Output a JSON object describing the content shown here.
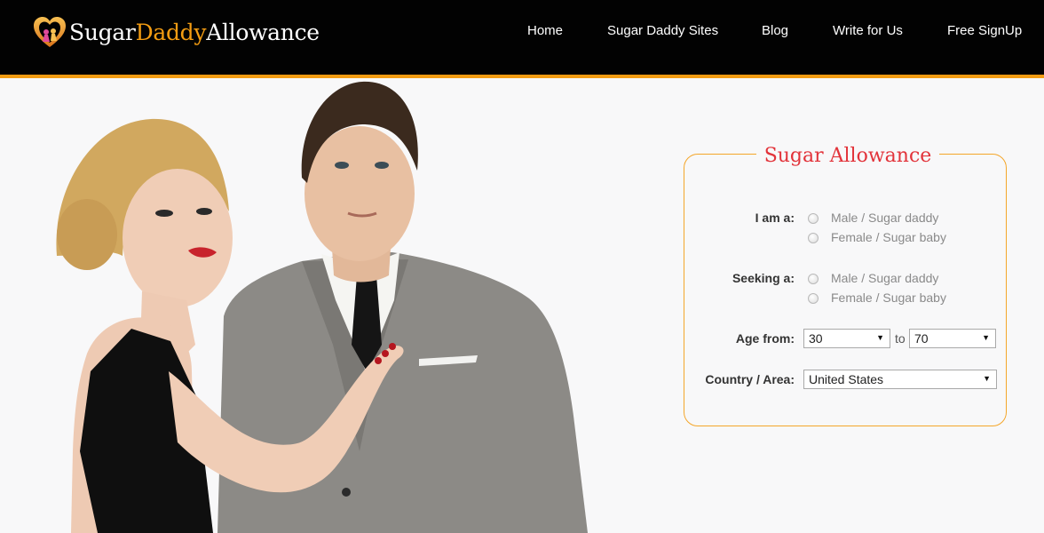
{
  "brand": {
    "logo_part1": "Sugar",
    "logo_part2": "Daddy",
    "logo_part3": "Allowance",
    "accent_color": "#f39c12"
  },
  "nav": {
    "items": [
      "Home",
      "Sugar Daddy Sites",
      "Blog",
      "Write for Us",
      "Free SignUp"
    ]
  },
  "hero": {
    "image": "couple-photo"
  },
  "form": {
    "title": "Sugar Allowance",
    "title_color": "#e2333a",
    "border_color": "#f4a62a",
    "i_am_label": "I am a:",
    "i_am_options": [
      "Male / Sugar daddy",
      "Female / Sugar baby"
    ],
    "seeking_label": "Seeking a:",
    "seeking_options": [
      "Male / Sugar daddy",
      "Female / Sugar baby"
    ],
    "age_label": "Age from:",
    "age_from": "30",
    "age_to_label": "to",
    "age_to": "70",
    "country_label": "Country / Area:",
    "country_value": "United States"
  }
}
